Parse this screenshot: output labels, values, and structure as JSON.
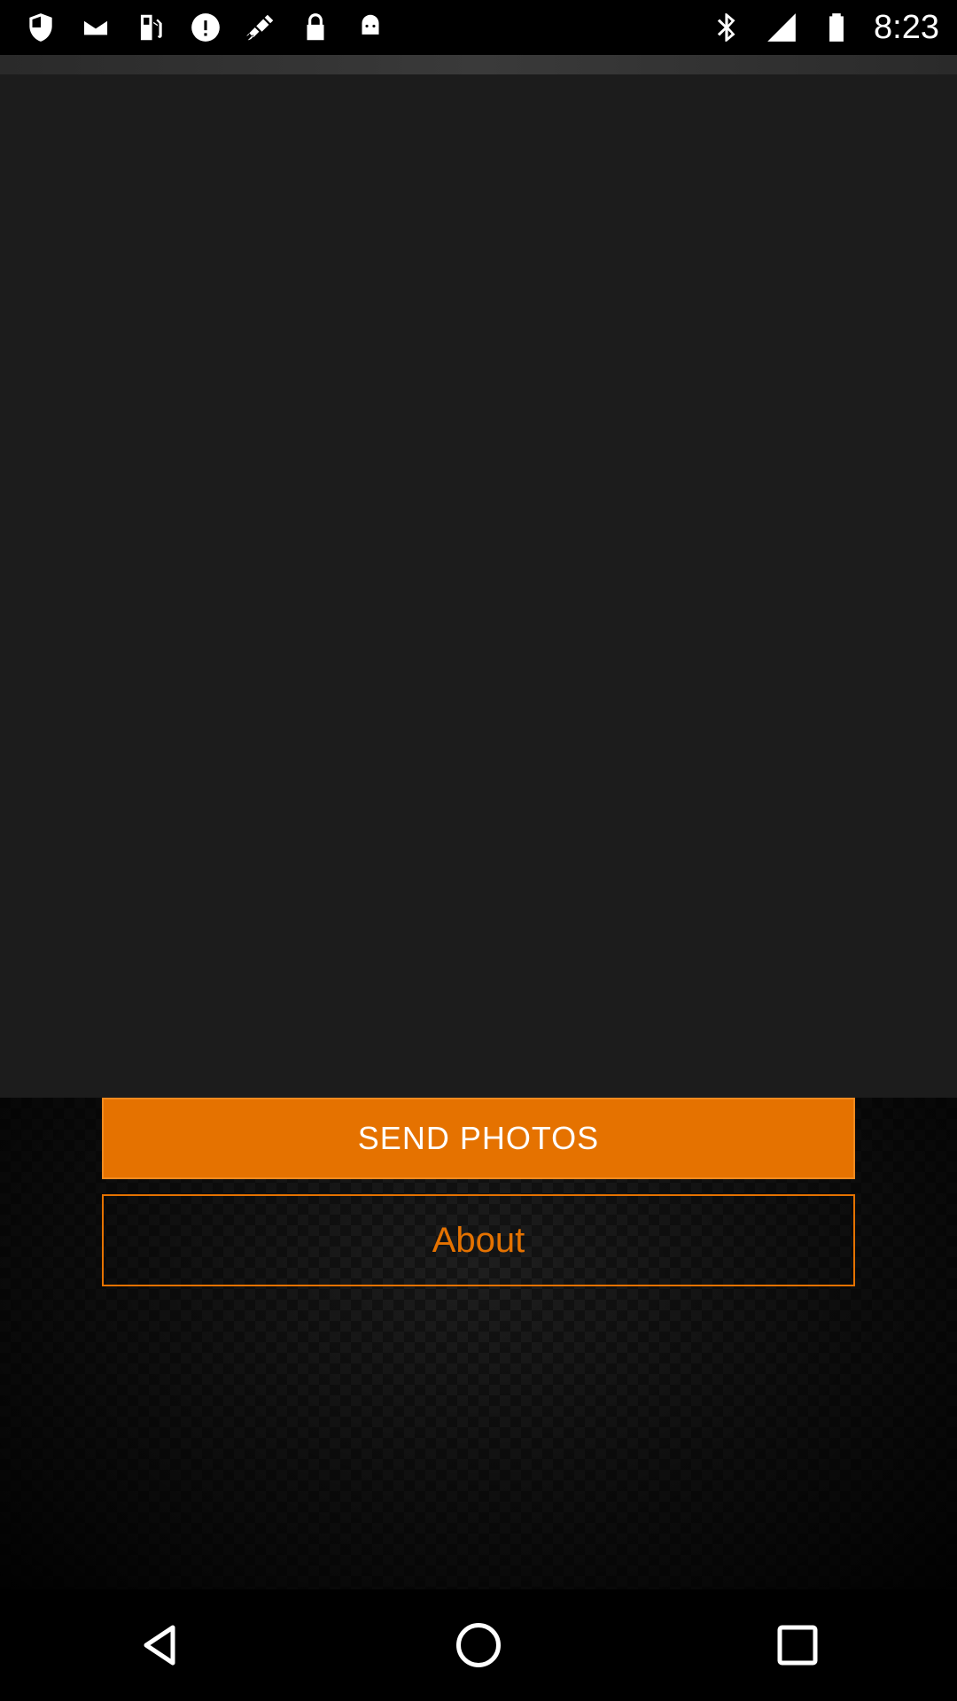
{
  "status_bar": {
    "left_icons": [
      "shield-icon",
      "mail-icon",
      "fuel-icon",
      "alert-icon",
      "fake-gps-icon",
      "lock-icon",
      "android-icon"
    ],
    "right_icons": [
      "bluetooth-icon",
      "signal-icon",
      "battery-icon"
    ],
    "time": "8:23"
  },
  "main": {
    "send_button_label": "SEND PHOTOS",
    "about_button_label": "About"
  },
  "colors": {
    "accent": "#e57200",
    "preview_bg": "#1c1c1c"
  },
  "nav_bar": {
    "icons": [
      "back-icon",
      "home-icon",
      "recents-icon"
    ]
  }
}
